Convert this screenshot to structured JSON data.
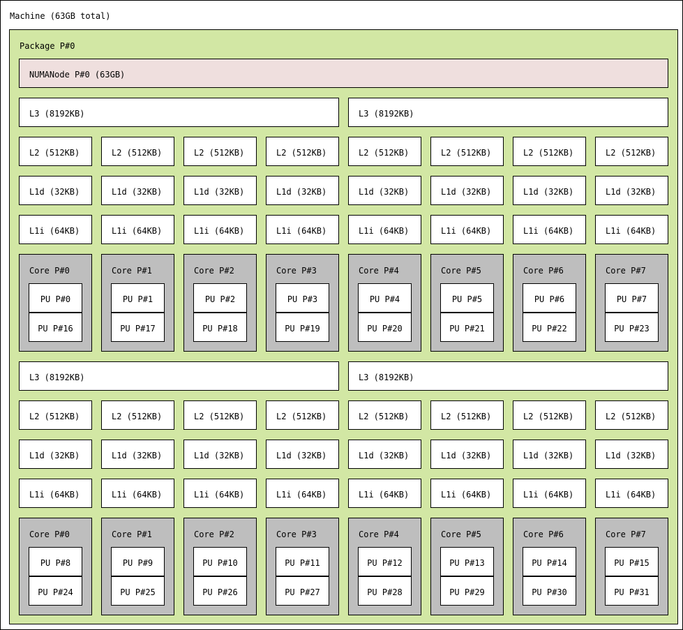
{
  "machine": {
    "label": "Machine (63GB total)"
  },
  "package": {
    "label": "Package P#0"
  },
  "numa": {
    "label": "NUMANode P#0 (63GB)"
  },
  "groups": [
    {
      "l3": [
        "L3 (8192KB)",
        "L3 (8192KB)"
      ],
      "cores": [
        {
          "l2": "L2 (512KB)",
          "l1d": "L1d (32KB)",
          "l1i": "L1i (64KB)",
          "core": "Core P#0",
          "pus": [
            "PU P#0",
            "PU P#16"
          ]
        },
        {
          "l2": "L2 (512KB)",
          "l1d": "L1d (32KB)",
          "l1i": "L1i (64KB)",
          "core": "Core P#1",
          "pus": [
            "PU P#1",
            "PU P#17"
          ]
        },
        {
          "l2": "L2 (512KB)",
          "l1d": "L1d (32KB)",
          "l1i": "L1i (64KB)",
          "core": "Core P#2",
          "pus": [
            "PU P#2",
            "PU P#18"
          ]
        },
        {
          "l2": "L2 (512KB)",
          "l1d": "L1d (32KB)",
          "l1i": "L1i (64KB)",
          "core": "Core P#3",
          "pus": [
            "PU P#3",
            "PU P#19"
          ]
        },
        {
          "l2": "L2 (512KB)",
          "l1d": "L1d (32KB)",
          "l1i": "L1i (64KB)",
          "core": "Core P#4",
          "pus": [
            "PU P#4",
            "PU P#20"
          ]
        },
        {
          "l2": "L2 (512KB)",
          "l1d": "L1d (32KB)",
          "l1i": "L1i (64KB)",
          "core": "Core P#5",
          "pus": [
            "PU P#5",
            "PU P#21"
          ]
        },
        {
          "l2": "L2 (512KB)",
          "l1d": "L1d (32KB)",
          "l1i": "L1i (64KB)",
          "core": "Core P#6",
          "pus": [
            "PU P#6",
            "PU P#22"
          ]
        },
        {
          "l2": "L2 (512KB)",
          "l1d": "L1d (32KB)",
          "l1i": "L1i (64KB)",
          "core": "Core P#7",
          "pus": [
            "PU P#7",
            "PU P#23"
          ]
        }
      ]
    },
    {
      "l3": [
        "L3 (8192KB)",
        "L3 (8192KB)"
      ],
      "cores": [
        {
          "l2": "L2 (512KB)",
          "l1d": "L1d (32KB)",
          "l1i": "L1i (64KB)",
          "core": "Core P#0",
          "pus": [
            "PU P#8",
            "PU P#24"
          ]
        },
        {
          "l2": "L2 (512KB)",
          "l1d": "L1d (32KB)",
          "l1i": "L1i (64KB)",
          "core": "Core P#1",
          "pus": [
            "PU P#9",
            "PU P#25"
          ]
        },
        {
          "l2": "L2 (512KB)",
          "l1d": "L1d (32KB)",
          "l1i": "L1i (64KB)",
          "core": "Core P#2",
          "pus": [
            "PU P#10",
            "PU P#26"
          ]
        },
        {
          "l2": "L2 (512KB)",
          "l1d": "L1d (32KB)",
          "l1i": "L1i (64KB)",
          "core": "Core P#3",
          "pus": [
            "PU P#11",
            "PU P#27"
          ]
        },
        {
          "l2": "L2 (512KB)",
          "l1d": "L1d (32KB)",
          "l1i": "L1i (64KB)",
          "core": "Core P#4",
          "pus": [
            "PU P#12",
            "PU P#28"
          ]
        },
        {
          "l2": "L2 (512KB)",
          "l1d": "L1d (32KB)",
          "l1i": "L1i (64KB)",
          "core": "Core P#5",
          "pus": [
            "PU P#13",
            "PU P#29"
          ]
        },
        {
          "l2": "L2 (512KB)",
          "l1d": "L1d (32KB)",
          "l1i": "L1i (64KB)",
          "core": "Core P#6",
          "pus": [
            "PU P#14",
            "PU P#30"
          ]
        },
        {
          "l2": "L2 (512KB)",
          "l1d": "L1d (32KB)",
          "l1i": "L1i (64KB)",
          "core": "Core P#7",
          "pus": [
            "PU P#15",
            "PU P#31"
          ]
        }
      ]
    }
  ],
  "colors": {
    "package": "#d2e7a4",
    "numa": "#efdfde",
    "cache": "#ffffff",
    "core": "#bebebe",
    "pu": "#ffffff"
  }
}
